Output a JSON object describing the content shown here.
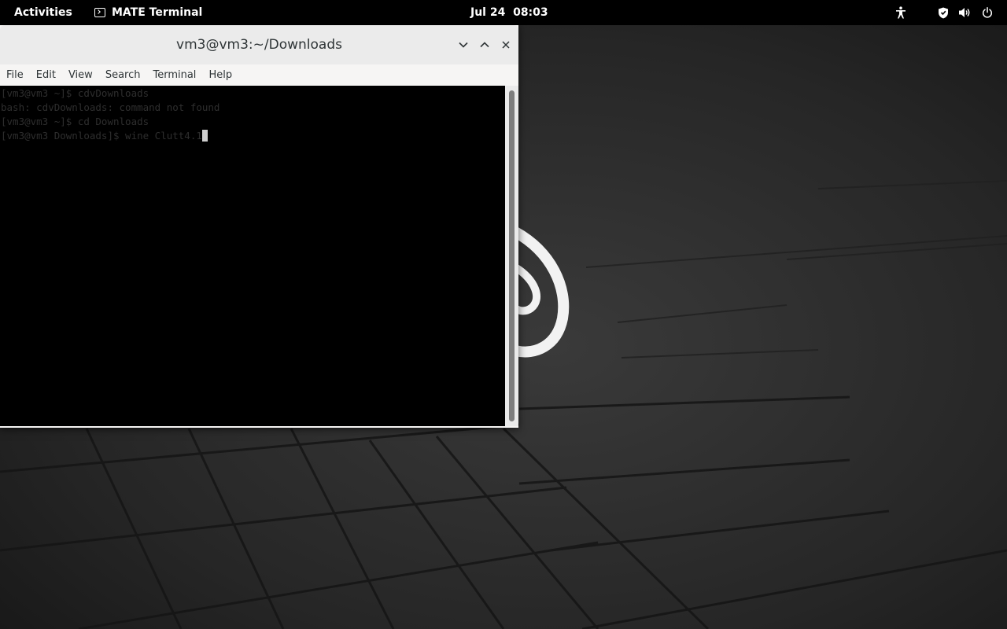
{
  "topbar": {
    "activities_label": "Activities",
    "app_name": "MATE Terminal",
    "clock": "Jul 24  08:03",
    "tray_icons": [
      "accessibility-icon",
      "shield-icon",
      "volume-icon",
      "power-icon"
    ]
  },
  "window": {
    "title": "vm3@vm3:~/Downloads",
    "controls": [
      "minimize-icon",
      "maximize-icon",
      "close-icon"
    ]
  },
  "menubar": {
    "items": [
      "File",
      "Edit",
      "View",
      "Search",
      "Terminal",
      "Help"
    ]
  },
  "terminal": {
    "lines": [
      "[vm3@vm3 ~]$ cdvDownloads",
      "bash: cdvDownloads: command not found",
      "[vm3@vm3 ~]$ cd Downloads",
      "[vm3@vm3 Downloads]$ wine Clutt4.1"
    ]
  },
  "colors": {
    "topbar_bg": "#000000",
    "terminal_bg": "#000000",
    "terminal_fg": "#2e2e2e",
    "titlebar_bg": "#ebebeb",
    "wallpaper": "#1c1c1c"
  }
}
